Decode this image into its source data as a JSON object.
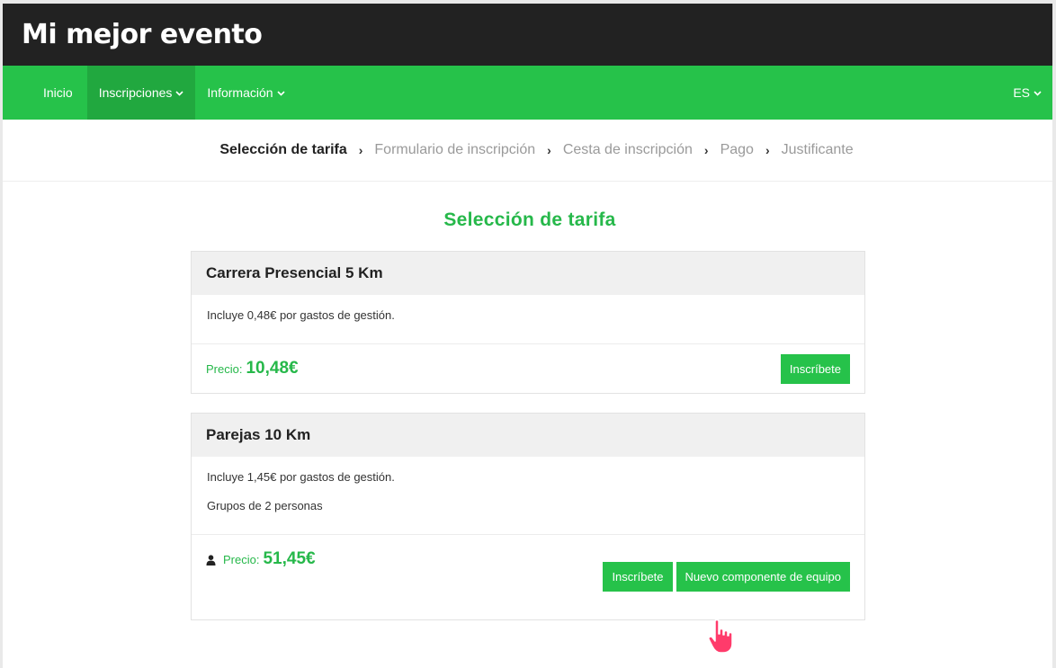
{
  "site": {
    "title": "Mi mejor evento"
  },
  "nav": {
    "items": [
      {
        "label": "Inicio"
      },
      {
        "label": "Inscripciones"
      },
      {
        "label": "Información"
      }
    ],
    "language": "ES"
  },
  "steps": [
    "Selección de tarifa",
    "Formulario de inscripción",
    "Cesta de inscripción",
    "Pago",
    "Justificante"
  ],
  "main": {
    "title": "Selección de tarifa",
    "rates": [
      {
        "name": "Carrera Presencial 5 Km",
        "notes": [
          "Incluye 0,48€ por gastos de gestión."
        ],
        "price_label": "Precio:",
        "price": "10,48€",
        "buttons": [
          "Inscríbete"
        ]
      },
      {
        "name": "Parejas 10 Km",
        "notes": [
          "Incluye 1,45€ por gastos de gestión.",
          "Grupos de 2 personas"
        ],
        "price_label": "Precio:",
        "price": "51,45€",
        "buttons": [
          "Inscríbete",
          "Nuevo componente de equipo"
        ]
      }
    ]
  },
  "colors": {
    "accent": "#26c24a",
    "header_bg": "#222222",
    "cursor": "#ff3b6b"
  },
  "icons": {
    "team_member": "user-icon",
    "nav_dropdown": "chevron-down-icon",
    "step_separator": "chevron-right-icon",
    "pointer": "hand-cursor-icon"
  }
}
